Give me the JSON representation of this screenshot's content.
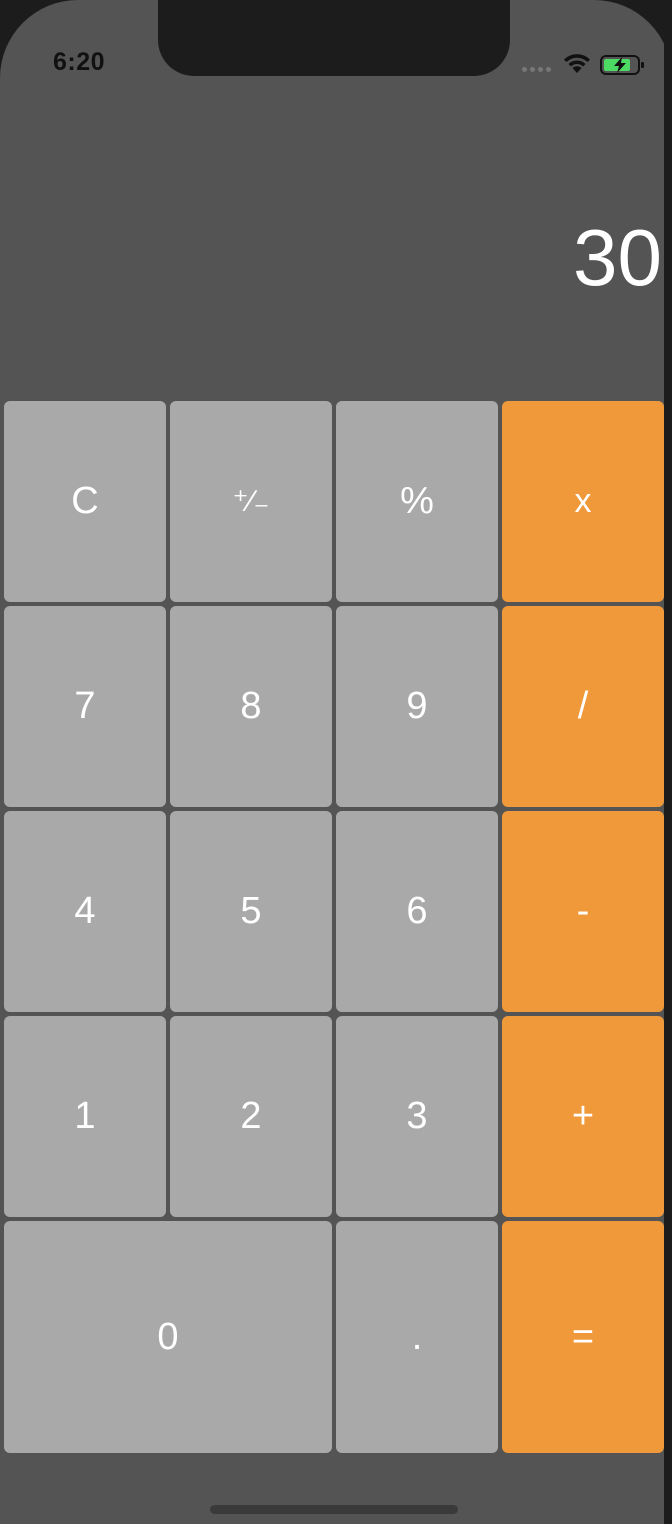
{
  "status_bar": {
    "time": "6:20"
  },
  "display": {
    "value": "30"
  },
  "keys": {
    "clear": "C",
    "plus_minus": "⁺∕₋",
    "percent": "%",
    "multiply": "x",
    "seven": "7",
    "eight": "8",
    "nine": "9",
    "divide": "/",
    "four": "4",
    "five": "5",
    "six": "6",
    "minus": "-",
    "one": "1",
    "two": "2",
    "three": "3",
    "plus": "+",
    "zero": "0",
    "decimal": ".",
    "equals": "="
  },
  "colors": {
    "background": "#545454",
    "key_grey": "#a9a9a9",
    "key_orange": "#f0993a",
    "text": "#ffffff"
  },
  "icons": {
    "wifi": "wifi-icon",
    "battery": "battery-charging-icon",
    "signal": "cellular-signal-icon"
  }
}
